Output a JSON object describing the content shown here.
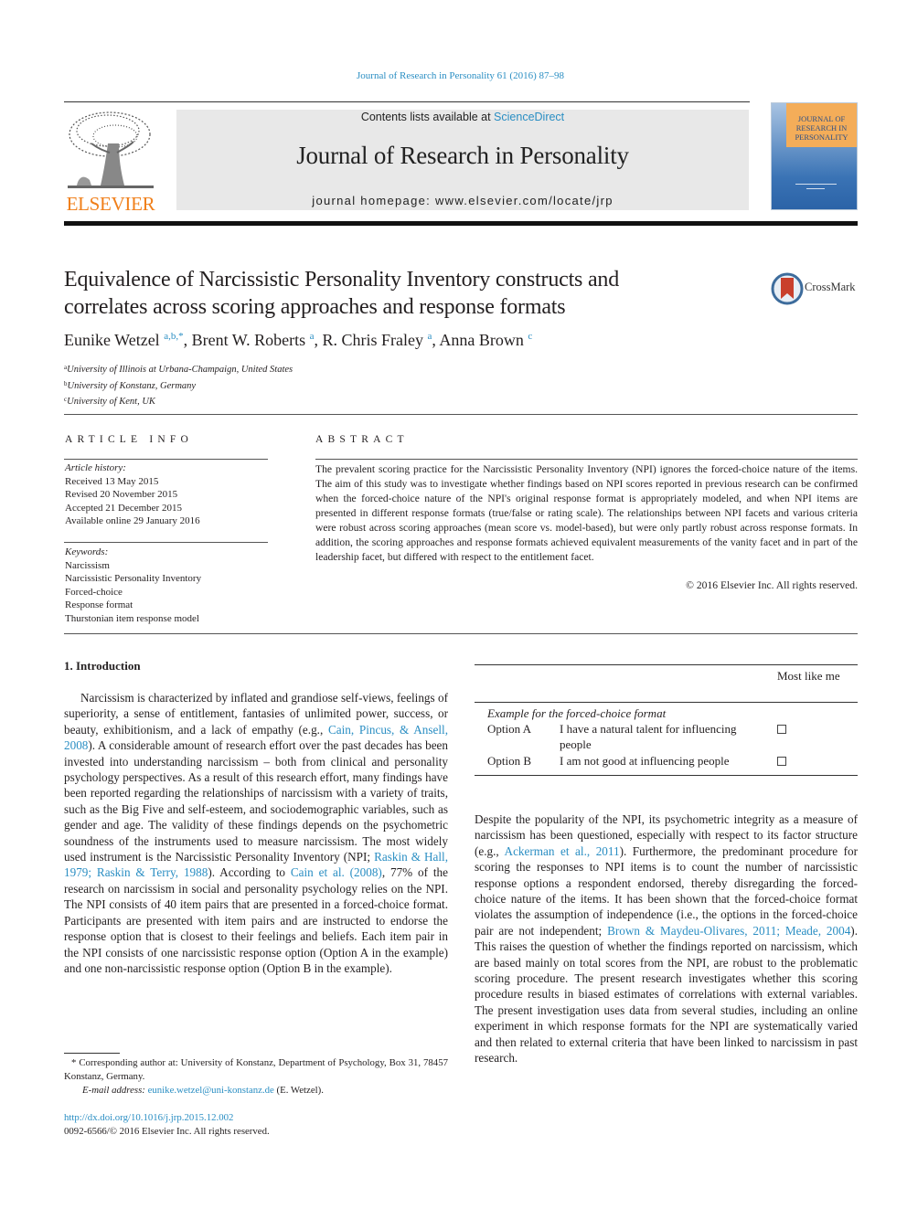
{
  "header": {
    "citation": "Journal of Research in Personality 61 (2016) 87–98",
    "publisher_logo": "ELSEVIER",
    "contents_prefix": "Contents lists available at ",
    "contents_link": "ScienceDirect",
    "journal_title": "Journal of Research in Personality",
    "homepage": "journal homepage: www.elsevier.com/locate/jrp",
    "cover_title_lines": [
      "JOURNAL OF",
      "RESEARCH IN",
      "PERSONALITY"
    ]
  },
  "crossmark": {
    "label": "CrossMark",
    "icon": "crossmark-icon"
  },
  "article": {
    "title_line1": "Equivalence of Narcissistic Personality Inventory constructs and",
    "title_line2": "correlates across scoring approaches and response formats",
    "authors": [
      {
        "name": "Eunike Wetzel",
        "sup": "a,b,*"
      },
      {
        "name": "Brent W. Roberts",
        "sup": "a"
      },
      {
        "name": "R. Chris Fraley",
        "sup": "a"
      },
      {
        "name": "Anna Brown",
        "sup": "c"
      }
    ],
    "affiliations": [
      {
        "sup": "a",
        "text": "University of Illinois at Urbana-Champaign, United States"
      },
      {
        "sup": "b",
        "text": "University of Konstanz, Germany"
      },
      {
        "sup": "c",
        "text": "University of Kent, UK"
      }
    ]
  },
  "article_info": {
    "heading": "ARTICLE INFO",
    "history_label": "Article history:",
    "history": [
      "Received 13 May 2015",
      "Revised 20 November 2015",
      "Accepted 21 December 2015",
      "Available online 29 January 2016"
    ],
    "keywords_label": "Keywords:",
    "keywords": [
      "Narcissism",
      "Narcissistic Personality Inventory",
      "Forced-choice",
      "Response format",
      "Thurstonian item response model"
    ]
  },
  "abstract": {
    "heading": "ABSTRACT",
    "text": "The prevalent scoring practice for the Narcissistic Personality Inventory (NPI) ignores the forced-choice nature of the items. The aim of this study was to investigate whether findings based on NPI scores reported in previous research can be confirmed when the forced-choice nature of the NPI's original response format is appropriately modeled, and when NPI items are presented in different response formats (true/false or rating scale). The relationships between NPI facets and various criteria were robust across scoring approaches (mean score vs. model-based), but were only partly robust across response formats. In addition, the scoring approaches and response formats achieved equivalent measurements of the vanity facet and in part of the leadership facet, but differed with respect to the entitlement facet.",
    "copyright": "© 2016 Elsevier Inc. All rights reserved."
  },
  "introduction": {
    "heading": "1. Introduction",
    "p1_a": "Narcissism is characterized by inflated and grandiose self-views, feelings of superiority, a sense of entitlement, fantasies of unlimited power, success, or beauty, exhibitionism, and a lack of empathy (e.g., ",
    "p1_link1": "Cain, Pincus, & Ansell, 2008",
    "p1_b": "). A considerable amount of research effort over the past decades has been invested into understanding narcissism – both from clinical and personality psychology perspectives. As a result of this research effort, many findings have been reported regarding the relationships of narcissism with a variety of traits, such as the Big Five and self-esteem, and sociodemographic variables, such as gender and age. The validity of these findings depends on the psychometric soundness of the instruments used to measure narcissism. The most widely used instrument is the Narcissistic Personality Inventory (NPI; ",
    "p1_link2": "Raskin & Hall, 1979; Raskin & Terry, 1988",
    "p1_c": "). According to ",
    "p1_link3": "Cain et al. (2008)",
    "p1_d": ", 77% of the research on narcissism in social and personality psychology relies on the NPI. The NPI consists of 40 item pairs that are presented in a forced-choice format. Participants are presented with item pairs and are instructed to endorse the response option that is closest to their feelings and beliefs. Each item pair in the NPI consists of one narcissistic response option (Option A in the example) and one non-narcissistic response option (Option B in the example).",
    "p2_a": "Despite the popularity of the NPI, its psychometric integrity as a measure of narcissism has been questioned, especially with respect to its factor structure (e.g., ",
    "p2_link1": "Ackerman et al., 2011",
    "p2_b": "). Furthermore, the predominant procedure for scoring the responses to NPI items is to count the number of narcissistic response options a respondent endorsed, thereby disregarding the forced-choice nature of the items. It has been shown that the forced-choice format violates the assumption of independence (i.e., the options in the forced-choice pair are not independent; ",
    "p2_link2": "Brown & Maydeu-Olivares, 2011; Meade, 2004",
    "p2_c": "). This raises the question of whether the findings reported on narcissism, which are based mainly on total scores from the NPI, are robust to the problematic scoring procedure. The present research investigates whether this scoring procedure results in biased estimates of correlations with external variables. The present investigation uses data from several studies, including an online experiment in which response formats for the NPI are systematically varied and then related to external criteria that have been linked to narcissism in past research."
  },
  "example_table": {
    "column_header": "Most like me",
    "caption": "Example for the forced-choice format",
    "rows": [
      {
        "option": "Option A",
        "text": "I have a natural talent for influencing people",
        "checked": false
      },
      {
        "option": "Option B",
        "text": "I am not good at influencing people",
        "checked": false
      }
    ]
  },
  "footnote": {
    "corresponding": "* Corresponding author at: University of Konstanz, Department of Psychology, Box 31, 78457 Konstanz, Germany.",
    "email_label": "E-mail address: ",
    "email": "eunike.wetzel@uni-konstanz.de",
    "email_suffix": " (E. Wetzel).",
    "doi": "http://dx.doi.org/10.1016/j.jrp.2015.12.002",
    "issn": "0092-6566/© 2016 Elsevier Inc. All rights reserved."
  }
}
